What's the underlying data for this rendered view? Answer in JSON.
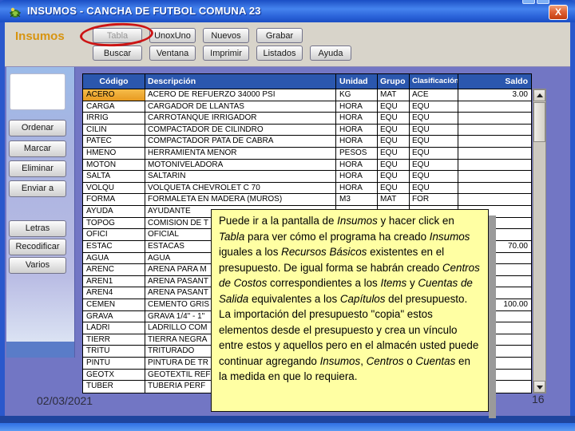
{
  "window": {
    "title": "INSUMOS - CANCHA DE FUTBOL COMUNA 23",
    "close_label": "X"
  },
  "toolbar": {
    "label": "Insumos",
    "rows": [
      {
        "buttons": [
          {
            "label": "Tabla",
            "disabled": true,
            "circled": true
          },
          {
            "label": "UnoxUno"
          },
          {
            "label": "Nuevos"
          },
          {
            "label": "Grabar"
          }
        ]
      },
      {
        "buttons": [
          {
            "label": "Buscar"
          },
          {
            "label": "Ventana"
          },
          {
            "label": "Imprimir"
          },
          {
            "label": "Listados"
          },
          {
            "label": "Ayuda"
          }
        ]
      }
    ]
  },
  "sidebar": {
    "buttons": [
      {
        "label": "Ordenar"
      },
      {
        "label": "Marcar"
      },
      {
        "label": "Eliminar"
      },
      {
        "label": "Enviar a"
      },
      {
        "label": "Letras"
      },
      {
        "label": "Recodificar"
      },
      {
        "label": "Varios"
      }
    ]
  },
  "table": {
    "columns": [
      "Código",
      "Descripción",
      "Unidad",
      "Grupo",
      "Clasificación",
      "Saldo"
    ],
    "rows": [
      [
        "ACERO",
        "ACERO DE REFUERZO 34000 PSI",
        "KG",
        "MAT",
        "ACE",
        "3.00"
      ],
      [
        "CARGA",
        "CARGADOR DE LLANTAS",
        "HORA",
        "EQU",
        "EQU",
        ""
      ],
      [
        "IRRIG",
        "CARROTANQUE IRRIGADOR",
        "HORA",
        "EQU",
        "EQU",
        ""
      ],
      [
        "CILIN",
        "COMPACTADOR DE CILINDRO",
        "HORA",
        "EQU",
        "EQU",
        ""
      ],
      [
        "PATEC",
        "COMPACTADOR PATA DE CABRA",
        "HORA",
        "EQU",
        "EQU",
        ""
      ],
      [
        "HMENO",
        "HERRAMIENTA MENOR",
        "PESOS",
        "EQU",
        "EQU",
        ""
      ],
      [
        "MOTON",
        "MOTONIVELADORA",
        "HORA",
        "EQU",
        "EQU",
        ""
      ],
      [
        "SALTA",
        "SALTARIN",
        "HORA",
        "EQU",
        "EQU",
        ""
      ],
      [
        "VOLQU",
        "VOLQUETA CHEVROLET C 70",
        "HORA",
        "EQU",
        "EQU",
        ""
      ],
      [
        "FORMA",
        "FORMALETA EN MADERA (MUROS)",
        "M3",
        "MAT",
        "FOR",
        ""
      ],
      [
        "AYUDA",
        "AYUDANTE",
        "",
        "",
        "",
        ""
      ],
      [
        "TOPOG",
        "COMISION DE T",
        "",
        "",
        "",
        ""
      ],
      [
        "OFICI",
        "OFICIAL",
        "",
        "",
        "",
        ""
      ],
      [
        "ESTAC",
        "ESTACAS",
        "",
        "",
        "",
        "70.00"
      ],
      [
        "AGUA",
        "AGUA",
        "",
        "",
        "",
        ""
      ],
      [
        "ARENC",
        "ARENA PARA M",
        "",
        "",
        "",
        ""
      ],
      [
        "AREN1",
        "ARENA PASANT",
        "",
        "",
        "",
        ""
      ],
      [
        "AREN4",
        "ARENA PASANT",
        "",
        "",
        "",
        ""
      ],
      [
        "CEMEN",
        "CEMENTO GRIS",
        "",
        "",
        "",
        "100.00"
      ],
      [
        "GRAVA",
        "GRAVA 1/4\" - 1\"",
        "",
        "",
        "",
        ""
      ],
      [
        "LADRI",
        "LADRILLO COM",
        "",
        "",
        "",
        ""
      ],
      [
        "TIERR",
        "TIERRA NEGRA",
        "",
        "",
        "",
        ""
      ],
      [
        "TRITU",
        "TRITURADO",
        "",
        "",
        "",
        ""
      ],
      [
        "PINTU",
        "PINTURA DE TR",
        "",
        "",
        "",
        ""
      ],
      [
        "GEOTX",
        "GEOTEXTIL REF",
        "",
        "",
        "",
        ""
      ],
      [
        "TUBER",
        "TUBERIA PERF",
        "",
        "",
        "",
        ""
      ]
    ],
    "selected_cell": {
      "row": 0,
      "column": "Código"
    }
  },
  "tooltip": {
    "segments": [
      {
        "t": "Puede ir a la pantalla de ",
        "i": false
      },
      {
        "t": "Insumos",
        "i": true
      },
      {
        "t": " y hacer click en ",
        "i": false
      },
      {
        "t": "Tabla",
        "i": true
      },
      {
        "t": " para ver cómo el programa ha creado ",
        "i": false
      },
      {
        "t": "Insumos",
        "i": true
      },
      {
        "t": " iguales a los ",
        "i": false
      },
      {
        "t": "Recursos Básicos",
        "i": true
      },
      {
        "t": " existentes en el presupuesto. De igual forma se habrán creado ",
        "i": false
      },
      {
        "t": "Centros de Costos",
        "i": true
      },
      {
        "t": " correspondientes a los ",
        "i": false
      },
      {
        "t": "Items",
        "i": true
      },
      {
        "t": " y ",
        "i": false
      },
      {
        "t": "Cuentas de Salida",
        "i": true
      },
      {
        "t": " equivalentes a los ",
        "i": false
      },
      {
        "t": "Capítulos",
        "i": true
      },
      {
        "t": " del presupuesto. La importación del presupuesto \"copia\" estos elementos desde el presupuesto y crea un vínculo entre estos y aquellos pero en el almacén usted puede continuar agregando ",
        "i": false
      },
      {
        "t": "Insumos",
        "i": true
      },
      {
        "t": ", ",
        "i": false
      },
      {
        "t": "Centros",
        "i": true
      },
      {
        "t": " o ",
        "i": false
      },
      {
        "t": "Cuentas",
        "i": true
      },
      {
        "t": " en la medida en que lo requiera.",
        "i": false
      }
    ]
  },
  "footer": {
    "date": "02/03/2021",
    "page": "16"
  },
  "colors": {
    "titlebar": "#2a62d8",
    "toolbar_bg": "#d8d4ca",
    "main_bg": "#7276c4",
    "table_header": "#2b57ae",
    "selected_cell": "#efa32f",
    "tooltip_bg": "#ffffa3",
    "highlight_ellipse": "#cc1414"
  }
}
